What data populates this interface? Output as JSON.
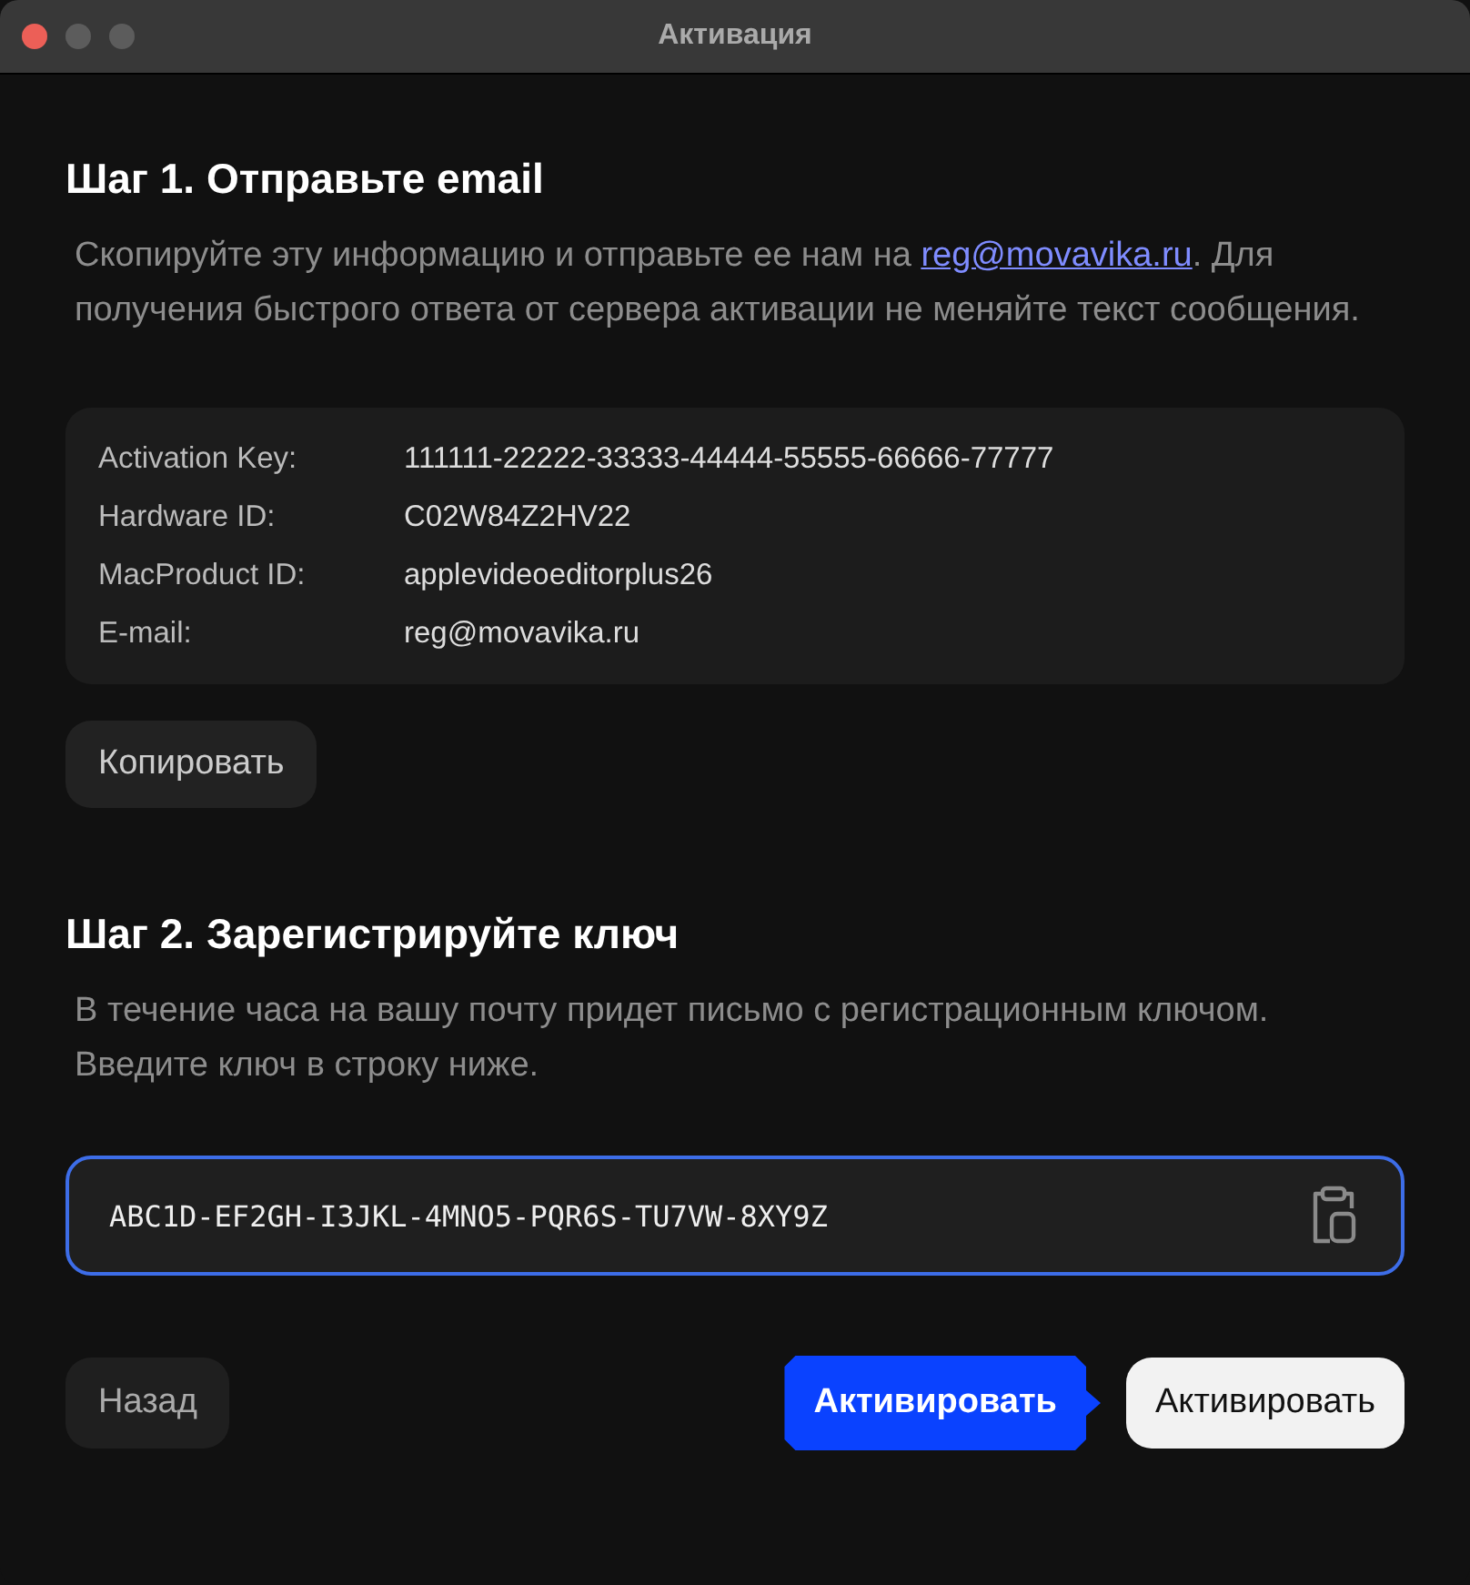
{
  "window": {
    "title": "Активация"
  },
  "step1": {
    "heading": "Шаг 1. Отправьте email",
    "text_before": "Скопируйте эту информацию и отправьте ее нам на ",
    "link": "reg@movavika.ru",
    "text_after": ". Для получения быстрого ответа от сервера активации не меняйте текст сообщения."
  },
  "info": [
    {
      "label": "Activation Key:",
      "value": "111111-22222-33333-44444-55555-66666-77777"
    },
    {
      "label": "Hardware ID:",
      "value": "C02W84Z2HV22"
    },
    {
      "label": "MacProduct ID:",
      "value": "applevideoeditorplus26"
    },
    {
      "label": "E-mail:",
      "value": "reg@movavika.ru"
    }
  ],
  "copy_button": "Копировать",
  "step2": {
    "heading": "Шаг 2. Зарегистрируйте ключ",
    "text": "В течение часа на вашу почту придет письмо с регистрационным ключом. Введите ключ в строку ниже."
  },
  "key_field": {
    "value": "ABC1D-EF2GH-I3JKL-4MNO5-PQR6S-TU7VW-8XY9Z",
    "focused": true
  },
  "back_button": "Назад",
  "callout": "Активировать",
  "activate_button": "Активировать"
}
